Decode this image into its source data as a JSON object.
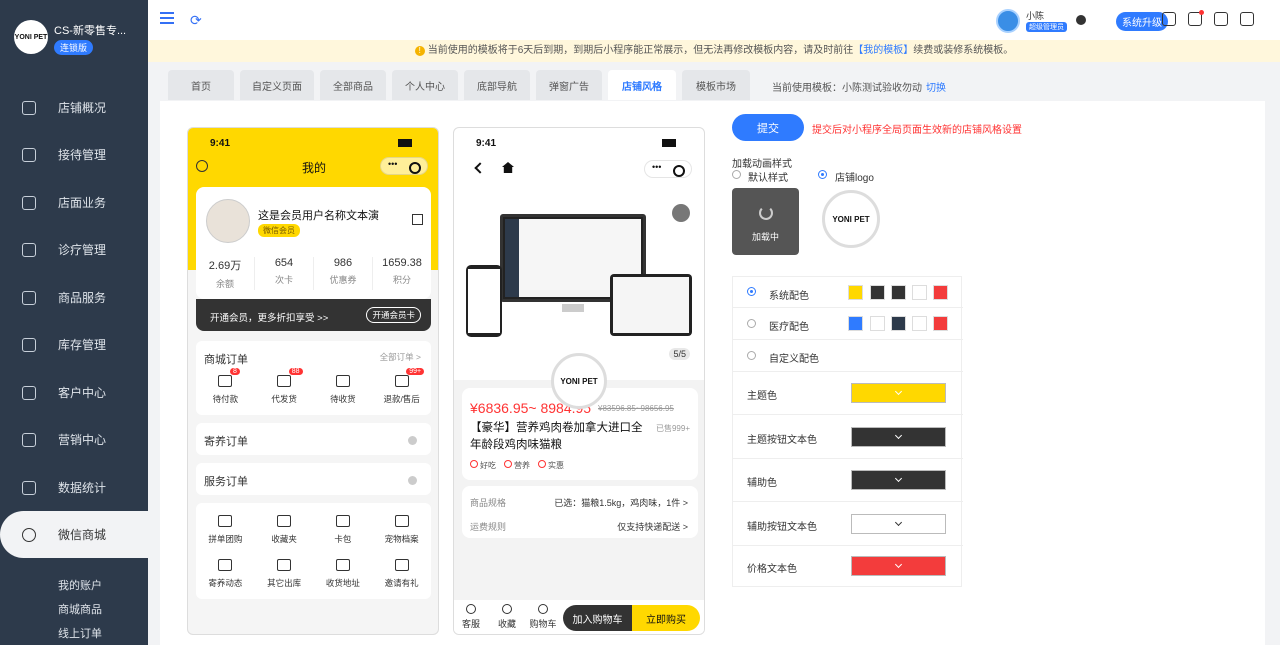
{
  "sidebar": {
    "brand_name": "CS-新零售专...",
    "brand_logo": "YONI PET",
    "brand_tag": "连锁版",
    "items": [
      "店铺概况",
      "接待管理",
      "店面业务",
      "诊疗管理",
      "商品服务",
      "库存管理",
      "客户中心",
      "营销中心",
      "数据统计",
      "微信商城"
    ],
    "active": "微信商城",
    "sub_items": [
      "我的账户",
      "商城商品",
      "线上订单"
    ]
  },
  "topbar": {
    "user_name": "小陈",
    "user_role": "超级管理员",
    "upgrade": "系统升级"
  },
  "notice": {
    "text": "当前使用的模板将于6天后到期，到期后小程序能正常展示，但无法再修改模板内容，请及时前往",
    "link": "【我的模板】",
    "tail": "续费或装修系统模板。"
  },
  "tabs": [
    "首页",
    "自定义页面",
    "全部商品",
    "个人中心",
    "底部导航",
    "弹窗广告",
    "店铺风格",
    "模板市场"
  ],
  "active_tab": "店铺风格",
  "current_template": {
    "label": "当前使用模板：小陈测试验收勿动",
    "switch": "切换"
  },
  "phone1": {
    "time": "9:41",
    "title": "我的",
    "member_name": "这是会员用户名称文本演",
    "member_tag": "微信会员",
    "stats": [
      {
        "v": "2.69万",
        "l": "余额"
      },
      {
        "v": "654",
        "l": "次卡"
      },
      {
        "v": "986",
        "l": "优惠券"
      },
      {
        "v": "1659.38",
        "l": "积分"
      }
    ],
    "vip_text": "开通会员，更多折扣享受 >>",
    "vip_btn": "开通会员卡",
    "orders_title": "商城订单",
    "orders_all": "全部订单 >",
    "order_items": [
      {
        "t": "待付款",
        "b": "8"
      },
      {
        "t": "代发货",
        "b": "88"
      },
      {
        "t": "待收货",
        "b": ""
      },
      {
        "t": "退款/售后",
        "b": "99+"
      }
    ],
    "foster": "寄养订单",
    "service": "服务订单",
    "grid": [
      "拼单团购",
      "收藏夹",
      "卡包",
      "宠物档案",
      "寄养动态",
      "其它出库",
      "收货地址",
      "邀请有礼"
    ]
  },
  "phone2": {
    "time": "9:41",
    "pager": "5/5",
    "logo": "YONI PET",
    "price": "¥6836.95~ 8984.95",
    "old_price": "¥83596.85~98656.95",
    "name": "【豪华】营养鸡肉卷加拿大进口全年龄段鸡肉味猫粮",
    "sold": "已售999+",
    "tags": [
      "好吃",
      "营养",
      "实惠"
    ],
    "spec_k": "商品规格",
    "spec_v": "已选：猫粮1.5kg，鸡肉味，1件 >",
    "ship_k": "运费规则",
    "ship_v": "仅支持快递配送 >",
    "bottom": [
      "客服",
      "收藏",
      "购物车"
    ],
    "cart": "加入购物车",
    "buy": "立即购买"
  },
  "settings": {
    "submit": "提交",
    "hint": "提交后对小程序全局页面生效新的店铺风格设置",
    "anim_label": "加载动画样式",
    "anim_opts": [
      "默认样式",
      "店铺logo"
    ],
    "loading": "加载中",
    "logo": "YONI PET",
    "schemes": [
      {
        "name": "系统配色",
        "colors": [
          "#ffd800",
          "#333333",
          "#333333",
          "#ffffff",
          "#f33c3c"
        ]
      },
      {
        "name": "医疗配色",
        "colors": [
          "#2f7bff",
          "#ffffff",
          "#2d3a4b",
          "#ffffff",
          "#f33c3c"
        ]
      },
      {
        "name": "自定义配色",
        "colors": []
      }
    ],
    "fields": [
      {
        "name": "主题色",
        "color": "#ffd800"
      },
      {
        "name": "主题按钮文本色",
        "color": "#333333"
      },
      {
        "name": "辅助色",
        "color": "#333333"
      },
      {
        "name": "辅助按钮文本色",
        "color": "#ffffff"
      },
      {
        "name": "价格文本色",
        "color": "#f33c3c"
      }
    ]
  }
}
